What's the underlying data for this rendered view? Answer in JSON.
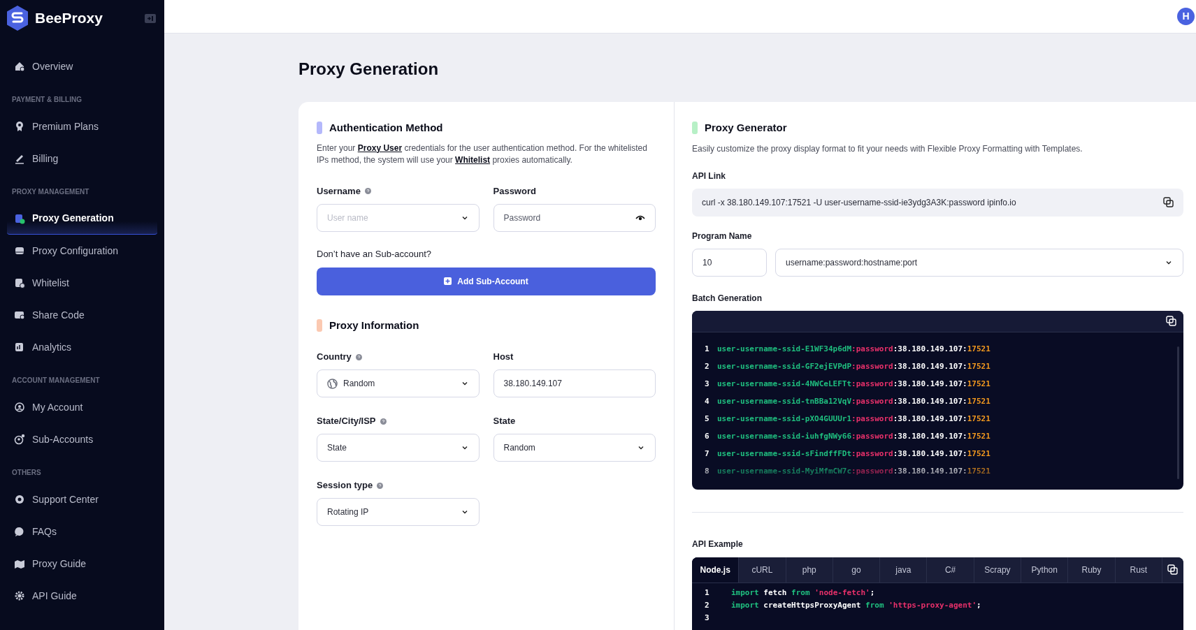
{
  "brand": {
    "name": "BeeProxy"
  },
  "sidebar": {
    "sections": [
      {
        "items": [
          {
            "label": "Overview",
            "selected": false
          }
        ]
      },
      {
        "heading": "PAYMENT & BILLING",
        "items": [
          {
            "label": "Premium Plans",
            "selected": false
          },
          {
            "label": "Billing",
            "selected": false
          }
        ]
      },
      {
        "heading": "PROXY MANAGEMENT",
        "items": [
          {
            "label": "Proxy Generation",
            "selected": true
          },
          {
            "label": "Proxy Configuration",
            "selected": false
          },
          {
            "label": "Whitelist",
            "selected": false
          },
          {
            "label": "Share Code",
            "selected": false
          },
          {
            "label": "Analytics",
            "selected": false
          }
        ]
      },
      {
        "heading": "ACCOUNT MANAGEMENT",
        "items": [
          {
            "label": "My Account",
            "selected": false
          },
          {
            "label": "Sub-Accounts",
            "selected": false
          }
        ]
      },
      {
        "heading": "OTHERS",
        "items": [
          {
            "label": "Support Center",
            "selected": false
          },
          {
            "label": "FAQs",
            "selected": false
          },
          {
            "label": "Proxy Guide",
            "selected": false
          },
          {
            "label": "API Guide",
            "selected": false
          }
        ]
      }
    ]
  },
  "header": {
    "avatar": "H"
  },
  "page_title": "Proxy Generation",
  "authentication": {
    "title": "Authentication Method",
    "color": "#b4b8fb",
    "description": [
      {
        "kind": "text",
        "text": "Enter your "
      },
      {
        "kind": "link",
        "text": "Proxy User"
      },
      {
        "kind": "text",
        "text": " credentials for the user authentication method. For the whitelisted IPs method, the system will use your "
      },
      {
        "kind": "link",
        "text": "Whitelist"
      },
      {
        "kind": "text",
        "text": " proxies automatically."
      }
    ],
    "fields": [
      {
        "label": "Username",
        "help_icon": true,
        "kind": "select",
        "placeholder": "User name"
      },
      {
        "label": "Password",
        "help_icon": false,
        "kind": "password",
        "placeholder": "Password"
      }
    ],
    "prompt": "Don’t have an Sub-account?",
    "button": "Add Sub-Account"
  },
  "proxy_information": {
    "title": "Proxy Information",
    "color": "#fbc9b1",
    "fields": [
      {
        "label": "Country",
        "help_icon": true,
        "kind": "country",
        "value": "Random"
      },
      {
        "label": "Host",
        "help_icon": false,
        "kind": "input",
        "value": "38.180.149.107"
      },
      {
        "label": "State/City/ISP",
        "help_icon": true,
        "kind": "select",
        "value": "State"
      },
      {
        "label": "State",
        "help_icon": false,
        "kind": "select",
        "value": "Random"
      },
      {
        "label": "Session type",
        "help_icon": true,
        "kind": "select",
        "value": "Rotating IP"
      }
    ]
  },
  "proxy_generator": {
    "title": "Proxy Generator",
    "color": "#b7f0c6",
    "description": "Easily customize the proxy display format to fit your needs with Flexible Proxy Formatting with Templates.",
    "api_link_label": "API Link",
    "api_link": "curl -x 38.180.149.107:17521 -U user-username-ssid-ie3ydg3A3K:password ipinfo.io",
    "program_name_label": "Program Name",
    "count": "10",
    "format": "username:password:hostname:port",
    "batch_label": "Batch Generation",
    "batch_lines": [
      {
        "number": "1",
        "user": "user-username-ssid-E1WF34p6dM",
        "password": ":password",
        "host": ":38.180.149.107:",
        "port": "17521"
      },
      {
        "number": "2",
        "user": "user-username-ssid-GF2ejEVPdP",
        "password": ":password",
        "host": ":38.180.149.107:",
        "port": "17521"
      },
      {
        "number": "3",
        "user": "user-username-ssid-4NWCeLEFTt",
        "password": ":password",
        "host": ":38.180.149.107:",
        "port": "17521"
      },
      {
        "number": "4",
        "user": "user-username-ssid-tnBBa12VqV",
        "password": ":password",
        "host": ":38.180.149.107:",
        "port": "17521"
      },
      {
        "number": "5",
        "user": "user-username-ssid-pXO4GUUUr1",
        "password": ":password",
        "host": ":38.180.149.107:",
        "port": "17521"
      },
      {
        "number": "6",
        "user": "user-username-ssid-iuhfgNWy66",
        "password": ":password",
        "host": ":38.180.149.107:",
        "port": "17521"
      },
      {
        "number": "7",
        "user": "user-username-ssid-sFindffFDt",
        "password": ":password",
        "host": ":38.180.149.107:",
        "port": "17521"
      },
      {
        "number": "8",
        "user": "user-username-ssid-MyiMfmCW7c",
        "password": ":password",
        "host": ":38.180.149.107:",
        "port": "17521"
      }
    ],
    "api_example_label": "API Example",
    "tabs": [
      {
        "label": "Node.js",
        "selected": true
      },
      {
        "label": "cURL",
        "selected": false
      },
      {
        "label": "php",
        "selected": false
      },
      {
        "label": "go",
        "selected": false
      },
      {
        "label": "java",
        "selected": false
      },
      {
        "label": "C#",
        "selected": false
      },
      {
        "label": "Scrapy",
        "selected": false
      },
      {
        "label": "Python",
        "selected": false
      },
      {
        "label": "Ruby",
        "selected": false
      },
      {
        "label": "Rust",
        "selected": false
      }
    ],
    "code_lines": [
      {
        "number": "1",
        "tokens": [
          {
            "kind": "keyword",
            "text": "import"
          },
          {
            "kind": "plain",
            "text": " fetch "
          },
          {
            "kind": "keyword",
            "text": "from "
          },
          {
            "kind": "string",
            "text": "'node-fetch'"
          },
          {
            "kind": "plain",
            "text": ";"
          }
        ]
      },
      {
        "number": "2",
        "tokens": [
          {
            "kind": "keyword",
            "text": "import"
          },
          {
            "kind": "plain",
            "text": " createHttpsProxyAgent "
          },
          {
            "kind": "keyword",
            "text": "from "
          },
          {
            "kind": "string",
            "text": "'https-proxy-agent'"
          },
          {
            "kind": "plain",
            "text": ";"
          }
        ]
      },
      {
        "number": "3"
      }
    ]
  }
}
